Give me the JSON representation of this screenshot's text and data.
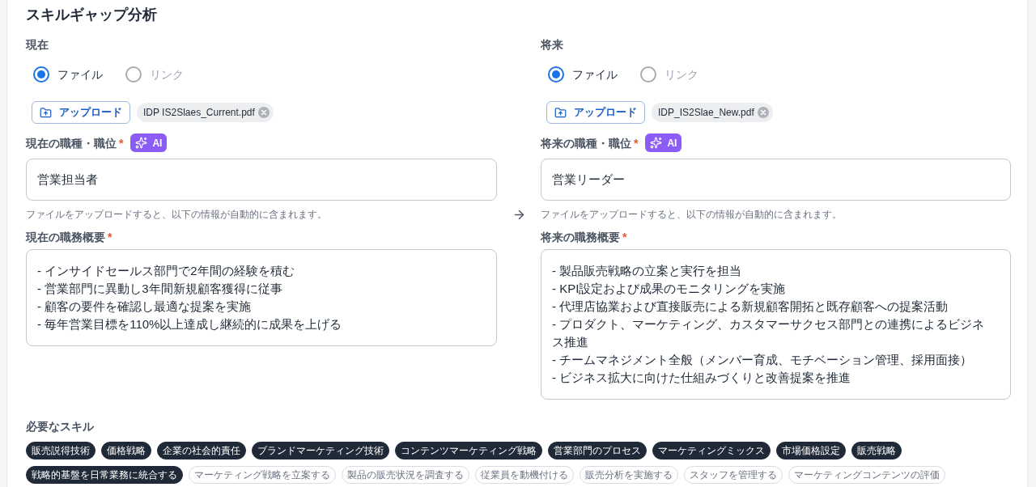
{
  "title": "スキルギャップ分析",
  "columns": [
    {
      "heading": "現在",
      "source_options": [
        {
          "label": "ファイル",
          "selected": true
        },
        {
          "label": "リンク",
          "selected": false
        }
      ],
      "upload_button": "アップロード",
      "file_chip": "IDP IS2Slaes_Current.pdf",
      "job_title": {
        "label": "現在の職種・職位",
        "required_mark": "*",
        "ai_badge": "AI",
        "value": "営業担当者"
      },
      "helper_text": "ファイルをアップロードすると、以下の情報が自動的に含まれます。",
      "job_summary": {
        "label": "現在の職務概要",
        "required_mark": "*",
        "value": "- インサイドセールス部門で2年間の経験を積む\n- 営業部門に異動し3年間新規顧客獲得に従事\n- 顧客の要件を確認し最適な提案を実施\n- 毎年営業目標を110%以上達成し継続的に成果を上げる"
      }
    },
    {
      "heading": "将来",
      "source_options": [
        {
          "label": "ファイル",
          "selected": true
        },
        {
          "label": "リンク",
          "selected": false
        }
      ],
      "upload_button": "アップロード",
      "file_chip": "IDP_IS2Slae_New.pdf",
      "job_title": {
        "label": "将来の職種・職位",
        "required_mark": "*",
        "ai_badge": "AI",
        "value": "営業リーダー"
      },
      "helper_text": "ファイルをアップロードすると、以下の情報が自動的に含まれます。",
      "job_summary": {
        "label": "将来の職務概要",
        "required_mark": "*",
        "value": "- 製品販売戦略の立案と実行を担当\n- KPI設定および成果のモニタリングを実施\n- 代理店協業および直接販売による新規顧客開拓と既存顧客への提案活動\n- プロダクト、マーケティング、カスタマーサクセス部門との連携によるビジネス推進\n- チームマネジメント全般（メンバー育成、モチベーション管理、採用面接）\n- ビジネス拡大に向けた仕組みづくりと改善提案を推進"
      }
    }
  ],
  "required_skills": {
    "label": "必要なスキル",
    "skills": [
      {
        "label": "販売説得技術",
        "selected": true
      },
      {
        "label": "価格戦略",
        "selected": true
      },
      {
        "label": "企業の社会的責任",
        "selected": true
      },
      {
        "label": "ブランドマーケティング技術",
        "selected": true
      },
      {
        "label": "コンテンツマーケティング戦略",
        "selected": true
      },
      {
        "label": "営業部門のプロセス",
        "selected": true
      },
      {
        "label": "マーケティングミックス",
        "selected": true
      },
      {
        "label": "市場価格設定",
        "selected": true
      },
      {
        "label": "販売戦略",
        "selected": true
      },
      {
        "label": "戦略的基盤を日常業務に統合する",
        "selected": true
      },
      {
        "label": "マーケティング戦略を立案する",
        "selected": false
      },
      {
        "label": "製品の販売状況を調査する",
        "selected": false
      },
      {
        "label": "従業員を動機付ける",
        "selected": false
      },
      {
        "label": "販売分析を実施する",
        "selected": false
      },
      {
        "label": "スタッフを管理する",
        "selected": false
      },
      {
        "label": "マーケティングコンテンツの評価",
        "selected": false
      }
    ]
  }
}
